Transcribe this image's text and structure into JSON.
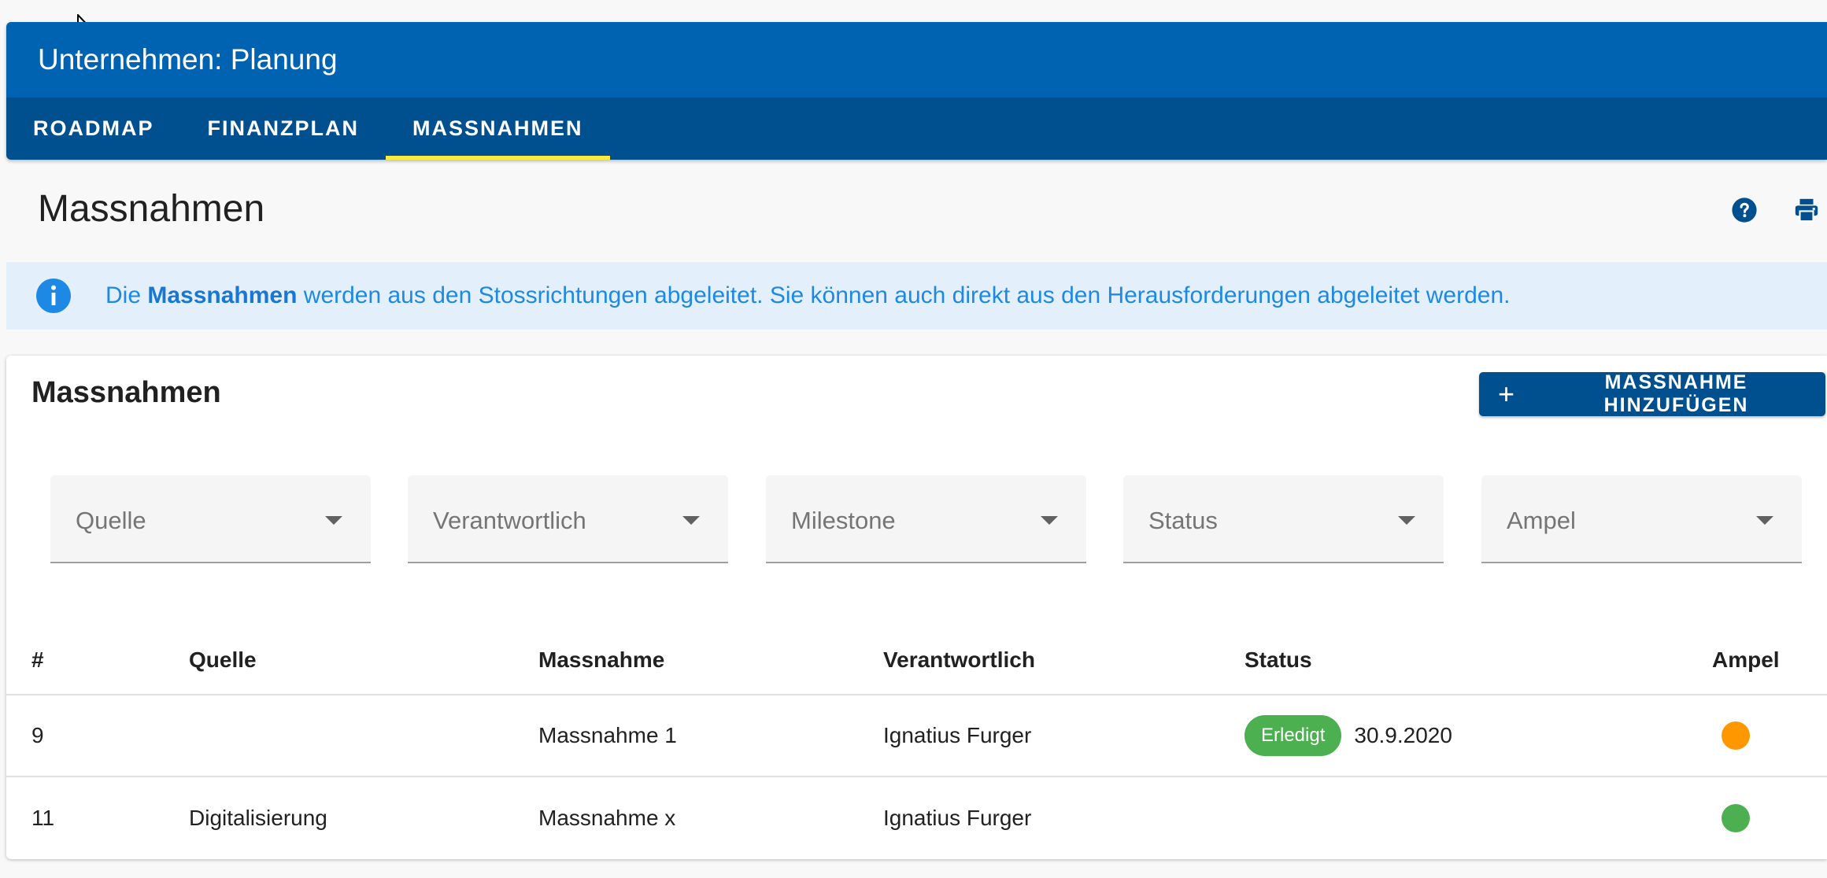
{
  "app": {
    "title": "Unternehmen: Planung",
    "tabs": [
      {
        "label": "ROADMAP",
        "active": false
      },
      {
        "label": "FINANZPLAN",
        "active": false
      },
      {
        "label": "MASSNAHMEN",
        "active": true
      }
    ]
  },
  "page": {
    "title": "Massnahmen",
    "icons": [
      "help-icon",
      "print-icon"
    ]
  },
  "info": {
    "prefix": "Die ",
    "bold": "Massnahmen",
    "suffix": " werden aus den Stossrichtungen abgeleitet. Sie können auch direkt aus den Herausforderungen abgeleitet werden."
  },
  "card": {
    "title": "Massnahmen",
    "add_button": "MASSNAHME HINZUFÜGEN",
    "filters": [
      "Quelle",
      "Verantwortlich",
      "Milestone",
      "Status",
      "Ampel"
    ],
    "columns": [
      "#",
      "Quelle",
      "Massnahme",
      "Verantwortlich",
      "Status",
      "Ampel"
    ],
    "rows": [
      {
        "id": "9",
        "quelle": "",
        "massnahme": "Massnahme 1",
        "verantwortlich": "Ignatius Furger",
        "status": "Erledigt",
        "status_date": "30.9.2020",
        "ampel": "#ff9800"
      },
      {
        "id": "11",
        "quelle": "Digitalisierung",
        "massnahme": "Massnahme x",
        "verantwortlich": "Ignatius Furger",
        "status": "",
        "status_date": "",
        "ampel": "#4caf50"
      }
    ]
  },
  "colors": {
    "primary": "#0063b1",
    "primary_dark": "#004f8f",
    "tab_indicator": "#ffeb3b",
    "info_text": "#1e88e5",
    "success": "#4caf50",
    "warning": "#ff9800"
  }
}
